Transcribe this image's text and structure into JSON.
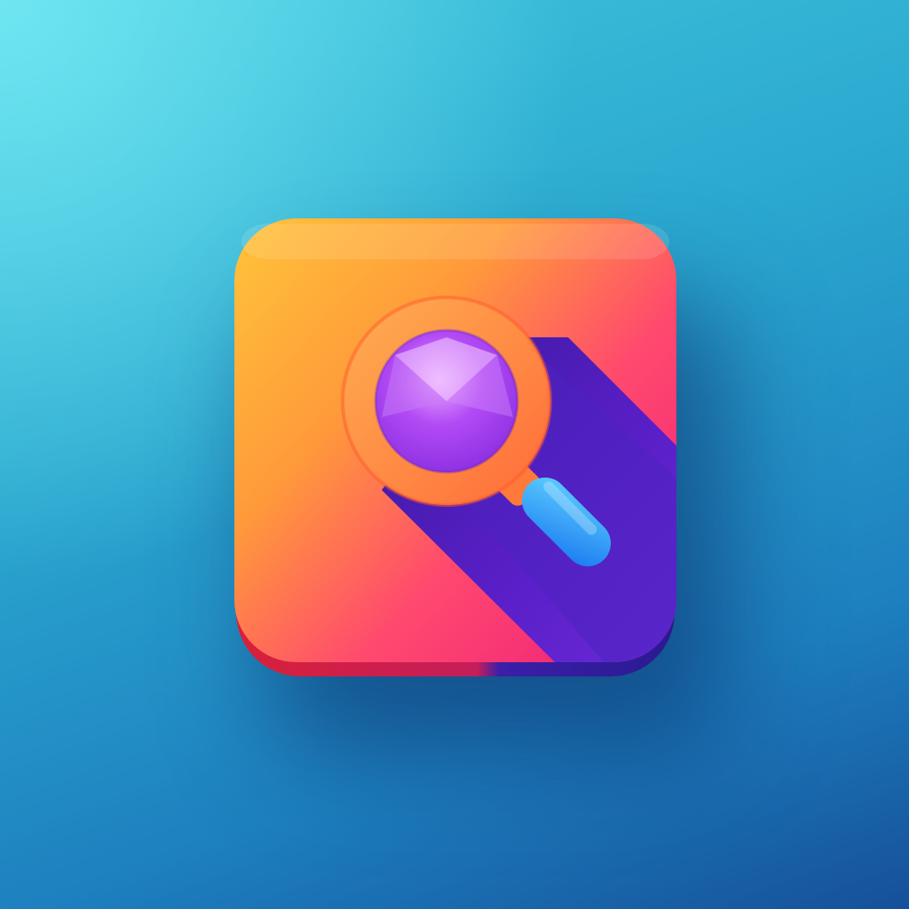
{
  "app_icon": {
    "name": "Search app icon",
    "icon": "magnifying-glass-icon",
    "colors": {
      "background_top": "#56d3e3",
      "background_bottom": "#16509a",
      "tile_orange": "#fdb53a",
      "tile_pink": "#ff3d7a",
      "shadow_purple": "#4a1fb8",
      "lens_ring": "#ff8a3d",
      "lens_glass": "#a03ff0",
      "handle": "#1f9dff"
    }
  }
}
